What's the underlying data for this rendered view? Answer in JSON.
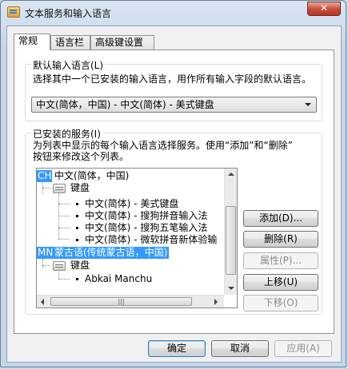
{
  "window": {
    "title": "文本服务和输入语言",
    "close_glyph": "✕"
  },
  "tabs": [
    {
      "label": "常规",
      "active": true
    },
    {
      "label": "语言栏",
      "active": false
    },
    {
      "label": "高级键设置",
      "active": false
    }
  ],
  "default_lang": {
    "group_label": "默认输入语言(L)",
    "description": "选择其中一个已安装的输入语言，用作所有输入字段的默认语言。",
    "selected": "中文(简体，中国) - 中文(简体) - 美式键盘"
  },
  "services": {
    "group_label": "已安装的服务(I)",
    "description_line1": "为列表中显示的每个输入语言选择服务。使用“添加”和“删除”",
    "description_line2": "按钮来修改这个列表。",
    "tree": {
      "lang1": {
        "badge": "CH",
        "name": "中文(简体，中国)"
      },
      "lang1_keyboard": "键盘",
      "lang1_items": [
        "中文(简体) - 美式键盘",
        "中文(简体) - 搜狗拼音输入法",
        "中文(简体) - 搜狗五笔输入法",
        "中文(简体) - 微软拼音新体验输"
      ],
      "lang2": {
        "badge": "MN",
        "name": "蒙古语(传统蒙古语，中国)"
      },
      "lang2_keyboard": "键盘",
      "lang2_items": [
        "Abkai Manchu"
      ]
    }
  },
  "side_buttons": {
    "add": "添加(D)...",
    "remove": "删除(R)",
    "properties": "属性(P)...",
    "move_up": "上移(U)",
    "move_down": "下移(O)"
  },
  "footer": {
    "ok": "确定",
    "cancel": "取消",
    "apply": "应用(A)"
  },
  "colors": {
    "selection": "#3399ff",
    "close_button": "#c7533f"
  }
}
